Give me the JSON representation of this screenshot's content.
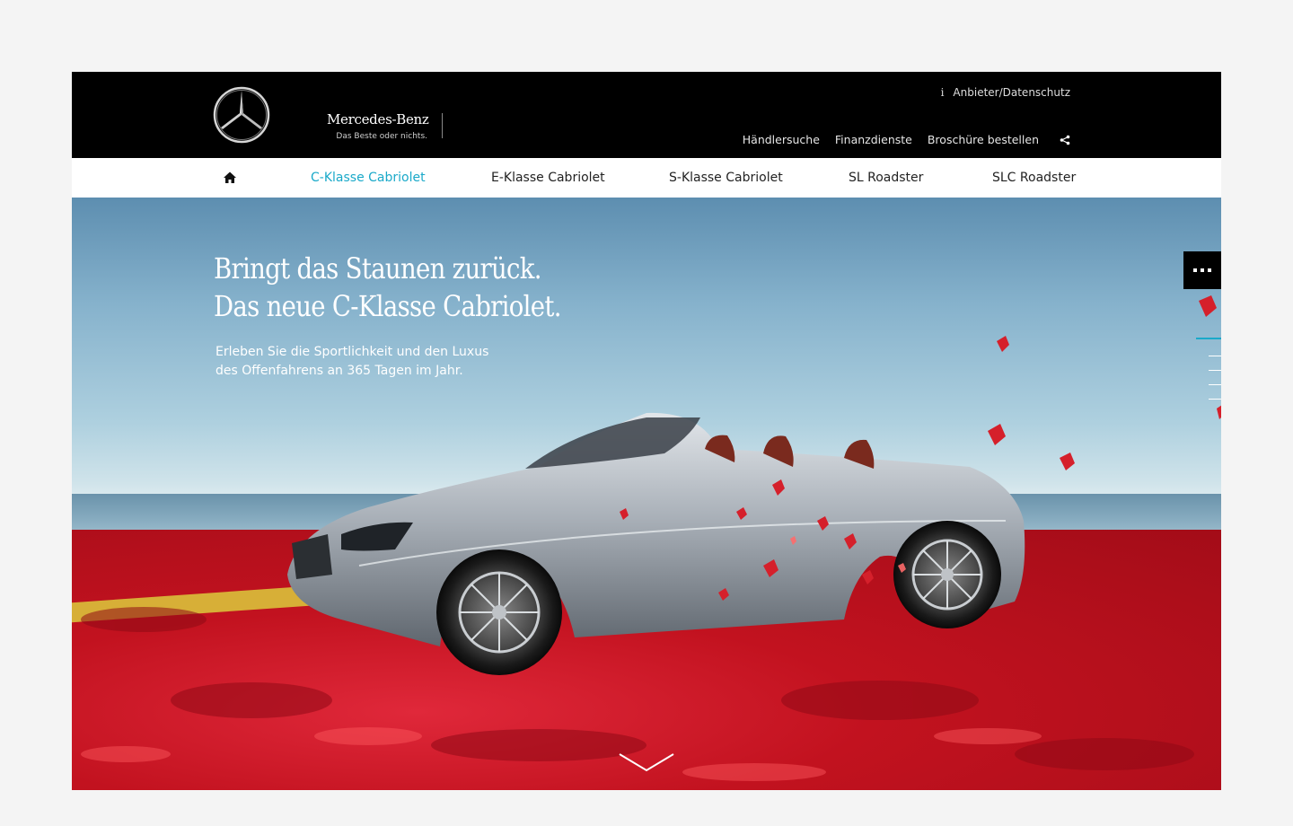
{
  "header": {
    "brand_name": "Mercedes-Benz",
    "brand_tagline": "Das Beste oder nichts.",
    "legal_link": "Anbieter/Datenschutz",
    "utility_nav": [
      "Händlersuche",
      "Finanzdienste",
      "Broschüre bestellen"
    ],
    "icons": [
      "mercedes-star-logo",
      "info-icon",
      "share-icon"
    ]
  },
  "mainnav": {
    "home_icon": "home-icon",
    "items": [
      {
        "label": "C-Klasse Cabriolet",
        "active": true
      },
      {
        "label": "E-Klasse Cabriolet",
        "active": false
      },
      {
        "label": "S-Klasse Cabriolet",
        "active": false
      },
      {
        "label": "SL Roadster",
        "active": false
      },
      {
        "label": "SLC Roadster",
        "active": false
      }
    ]
  },
  "hero": {
    "headline_line1": "Bringt das Staunen zurück.",
    "headline_line2": "Das neue C-Klasse Cabriolet.",
    "subtext": "Erleben Sie die Sportlichkeit und den Luxus des Offenfahrens an 365 Tagen im Jahr.",
    "icons": [
      "more-dots-icon",
      "chevron-down-icon"
    ]
  },
  "colors": {
    "accent": "#1aa9c9",
    "header_bg": "#000000",
    "nav_bg": "#ffffff",
    "page_bg": "#f4f4f4"
  }
}
